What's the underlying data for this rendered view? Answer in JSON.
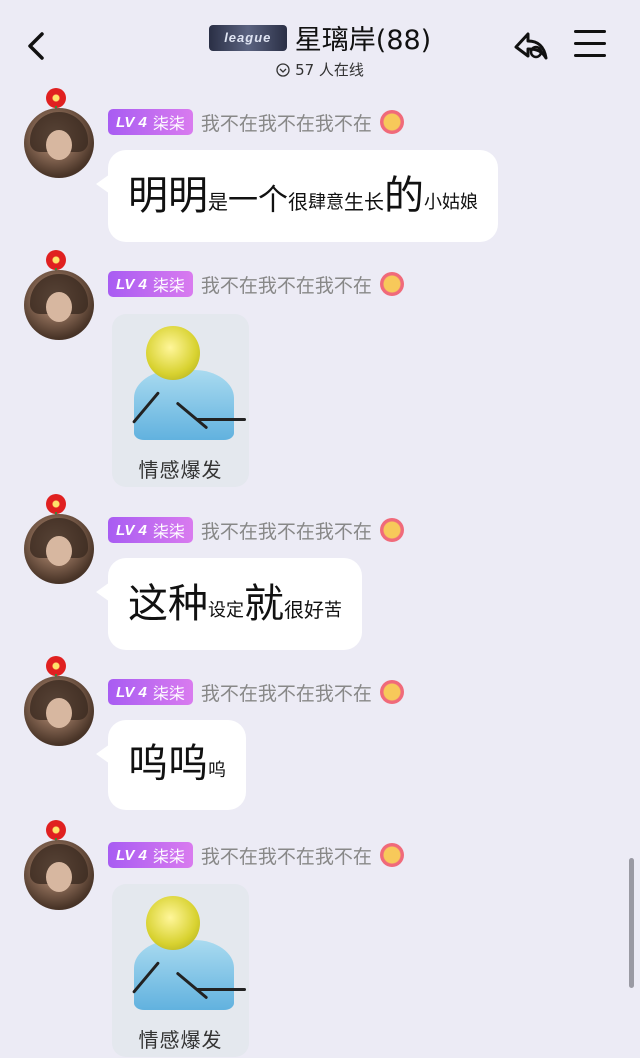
{
  "header": {
    "group_badge": "league",
    "title": "星璃岸(88)",
    "online": "57 人在线"
  },
  "messages": [
    {
      "level": "LV 4",
      "sender": "柒柒",
      "nickname": "我不在我不在我不在",
      "type": "text",
      "segments": [
        {
          "text": "明明",
          "size": "big"
        },
        {
          "text": "是",
          "size": "sm"
        },
        {
          "text": "一个",
          "size": "mid"
        },
        {
          "text": "很",
          "size": "sm"
        },
        {
          "text": "肆意",
          "size": "xs"
        },
        {
          "text": "生长",
          "size": "sm"
        },
        {
          "text": "的",
          "size": "big"
        },
        {
          "text": "小姑娘",
          "size": "xs"
        }
      ]
    },
    {
      "level": "LV 4",
      "sender": "柒柒",
      "nickname": "我不在我不在我不在",
      "type": "sticker",
      "caption": "情感爆发"
    },
    {
      "level": "LV 4",
      "sender": "柒柒",
      "nickname": "我不在我不在我不在",
      "type": "text",
      "segments": [
        {
          "text": "这种",
          "size": "big"
        },
        {
          "text": "设定",
          "size": "xs"
        },
        {
          "text": "就",
          "size": "big"
        },
        {
          "text": "很好",
          "size": "sm"
        },
        {
          "text": "苦",
          "size": "xs"
        }
      ]
    },
    {
      "level": "LV 4",
      "sender": "柒柒",
      "nickname": "我不在我不在我不在",
      "type": "text",
      "segments": [
        {
          "text": "呜呜",
          "size": "big"
        },
        {
          "text": "呜",
          "size": "xs"
        }
      ]
    },
    {
      "level": "LV 4",
      "sender": "柒柒",
      "nickname": "我不在我不在我不在",
      "type": "sticker",
      "caption": "情感爆发"
    }
  ]
}
